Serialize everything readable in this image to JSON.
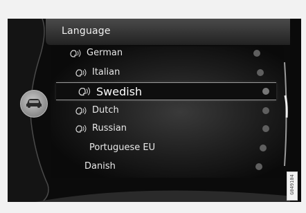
{
  "header": {
    "title": "Language"
  },
  "languages": [
    {
      "label": "German",
      "voice": true,
      "selected": false
    },
    {
      "label": "Italian",
      "voice": true,
      "selected": false
    },
    {
      "label": "Swedish",
      "voice": true,
      "selected": true
    },
    {
      "label": "Dutch",
      "voice": true,
      "selected": false
    },
    {
      "label": "Russian",
      "voice": true,
      "selected": false
    },
    {
      "label": "Portuguese EU",
      "voice": false,
      "selected": false
    },
    {
      "label": "Danish",
      "voice": false,
      "selected": false
    }
  ],
  "icons": {
    "voice": "voice-control-icon",
    "car": "car-icon"
  },
  "watermark": "G049104",
  "colors": {
    "screen": "#0c0c0c",
    "frame": "#f2f2f2",
    "text": "#e8e8e8"
  }
}
